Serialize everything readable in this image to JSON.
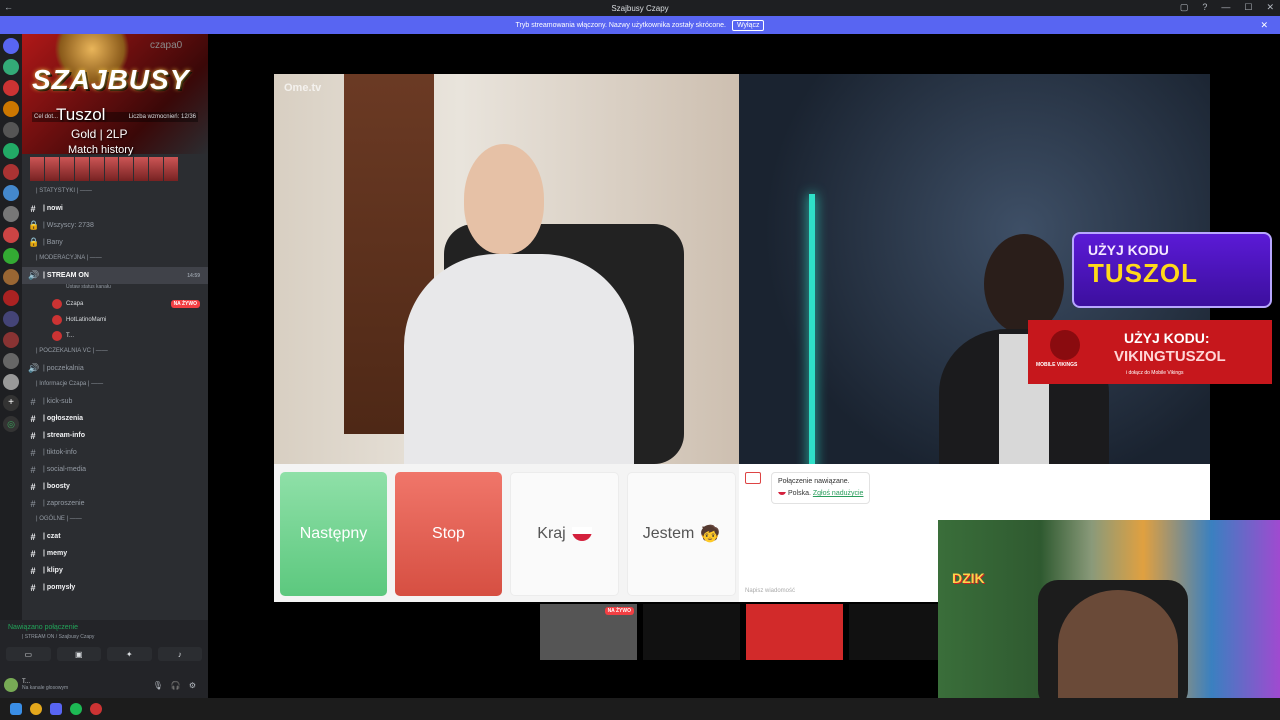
{
  "window": {
    "title": "Szajbusy Czapy"
  },
  "banner": {
    "text": "Tryb streamowania włączony. Nazwy użytkownika zostały skrócone.",
    "button": "Wyłącz"
  },
  "server": {
    "logo": "SZAJBUSY",
    "username_overlay": "czapa0",
    "boost_left": "Cel dot...",
    "boost_right": "Liczba wzmocnień: 12/36",
    "overlay_name": "Tuszol",
    "overlay_rank": "Gold | 2LP",
    "overlay_history": "Match history"
  },
  "channels": {
    "items": [
      {
        "type": "cat",
        "label": "| STATYSTYKI | ——"
      },
      {
        "type": "ch",
        "icon": "#",
        "label": "| nowi",
        "bold": true
      },
      {
        "type": "ch",
        "icon": "🔒",
        "label": "| Wszyscy: 2738"
      },
      {
        "type": "ch",
        "icon": "🔒",
        "label": "| Bany"
      },
      {
        "type": "cat",
        "label": "| MODERACYJNA | ——"
      },
      {
        "type": "ch",
        "icon": "🔊",
        "label": "| STREAM ON",
        "bold": true,
        "active": true,
        "time": "14:59"
      },
      {
        "type": "sub",
        "label": "Ustaw status kanału"
      },
      {
        "type": "user",
        "label": "Czapa",
        "live": "NA ŻYWO"
      },
      {
        "type": "user",
        "label": "HotLatinoMami"
      },
      {
        "type": "user",
        "label": "T..."
      },
      {
        "type": "cat",
        "label": "| POCZEKALNIA VC | ——"
      },
      {
        "type": "ch",
        "icon": "🔊",
        "label": "| poczekalnia"
      },
      {
        "type": "cat",
        "label": "| Informacje Czapa | ——"
      },
      {
        "type": "ch",
        "icon": "#",
        "label": "| kick-sub"
      },
      {
        "type": "ch",
        "icon": "#",
        "label": "| ogłoszenia",
        "bold": true
      },
      {
        "type": "ch",
        "icon": "#",
        "label": "| stream-info",
        "bold": true
      },
      {
        "type": "ch",
        "icon": "#",
        "label": "| tiktok-info"
      },
      {
        "type": "ch",
        "icon": "#",
        "label": "| social-media"
      },
      {
        "type": "ch",
        "icon": "#",
        "label": "| boosty",
        "bold": true
      },
      {
        "type": "ch",
        "icon": "#",
        "label": "| zaproszenie"
      },
      {
        "type": "cat",
        "label": "| OGÓLNE | ——"
      },
      {
        "type": "ch",
        "icon": "#",
        "label": "| czat",
        "bold": true
      },
      {
        "type": "ch",
        "icon": "#",
        "label": "| memy",
        "bold": true
      },
      {
        "type": "ch",
        "icon": "#",
        "label": "| klipy",
        "bold": true
      },
      {
        "type": "ch",
        "icon": "#",
        "label": "| pomysły",
        "bold": true
      }
    ]
  },
  "voice_panel": {
    "status": "Nawiązano połączenie",
    "sub": "| STREAM ON / Szajbusy Czapy",
    "user_name": "T...",
    "user_status": "Na kanale głosowym"
  },
  "ometv": {
    "logo": "Ome.tv",
    "next": "Następny",
    "stop": "Stop",
    "country": "Kraj",
    "gender": "Jestem",
    "chat_msg1": "Połączenie nawiązane.",
    "chat_msg2": "Polska",
    "chat_report": "Zgłoś nadużycie",
    "chat_placeholder": "Napisz wiadomość"
  },
  "promo": {
    "p1_line1": "UŻYJ KODU",
    "p1_line2": "TUSZOL",
    "p2_line1": "UŻYJ KODU:",
    "p2_line2": "VIKINGTUSZOL",
    "p2_line3": "i dołącz do Mobile Vikings",
    "p2_brand": "MOBILE VIKINGS"
  },
  "thumbs": {
    "live": "NA ŻYWO"
  },
  "facecam": {
    "sign": "DZIK"
  }
}
